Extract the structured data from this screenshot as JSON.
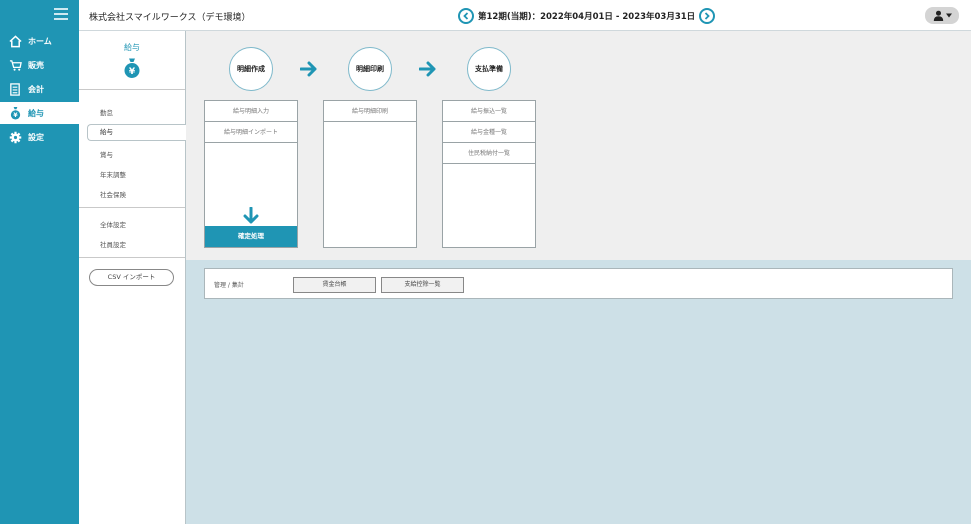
{
  "nav": {
    "items": [
      {
        "label": "ホーム",
        "icon": "home-icon"
      },
      {
        "label": "販売",
        "icon": "cart-icon"
      },
      {
        "label": "会計",
        "icon": "ledger-icon"
      },
      {
        "label": "給与",
        "icon": "moneybag-icon"
      },
      {
        "label": "設定",
        "icon": "gear-icon"
      }
    ],
    "active_index": 3
  },
  "header": {
    "company": "株式会社スマイルワークス（デモ環境）",
    "period": "第12期(当期)：2022年04月01日 - 2023年03月31日"
  },
  "subnav": {
    "title": "給与",
    "moneybag_symbol": "¥",
    "items": [
      "勤怠",
      "給与",
      "賞与",
      "年末調整",
      "社会保険",
      "全体設定",
      "社員設定"
    ],
    "active_index": 1,
    "csv_button": "CSV インポート"
  },
  "workflow": {
    "steps": [
      "明細作成",
      "明細印刷",
      "支払準備"
    ],
    "panels": [
      {
        "items": [
          "給与明細入力",
          "給与明細インポート"
        ],
        "confirm": "確定処理"
      },
      {
        "items": [
          "給与明細印刷"
        ]
      },
      {
        "items": [
          "給与振込一覧",
          "給与金種一覧",
          "住民税納付一覧"
        ]
      }
    ]
  },
  "management": {
    "label": "管理 / 集計",
    "buttons": [
      "賃金台帳",
      "支給控除一覧"
    ]
  },
  "colors": {
    "accent": "#1f95b4",
    "top_area": "#efefef",
    "bottom_area": "#cde0e7"
  }
}
